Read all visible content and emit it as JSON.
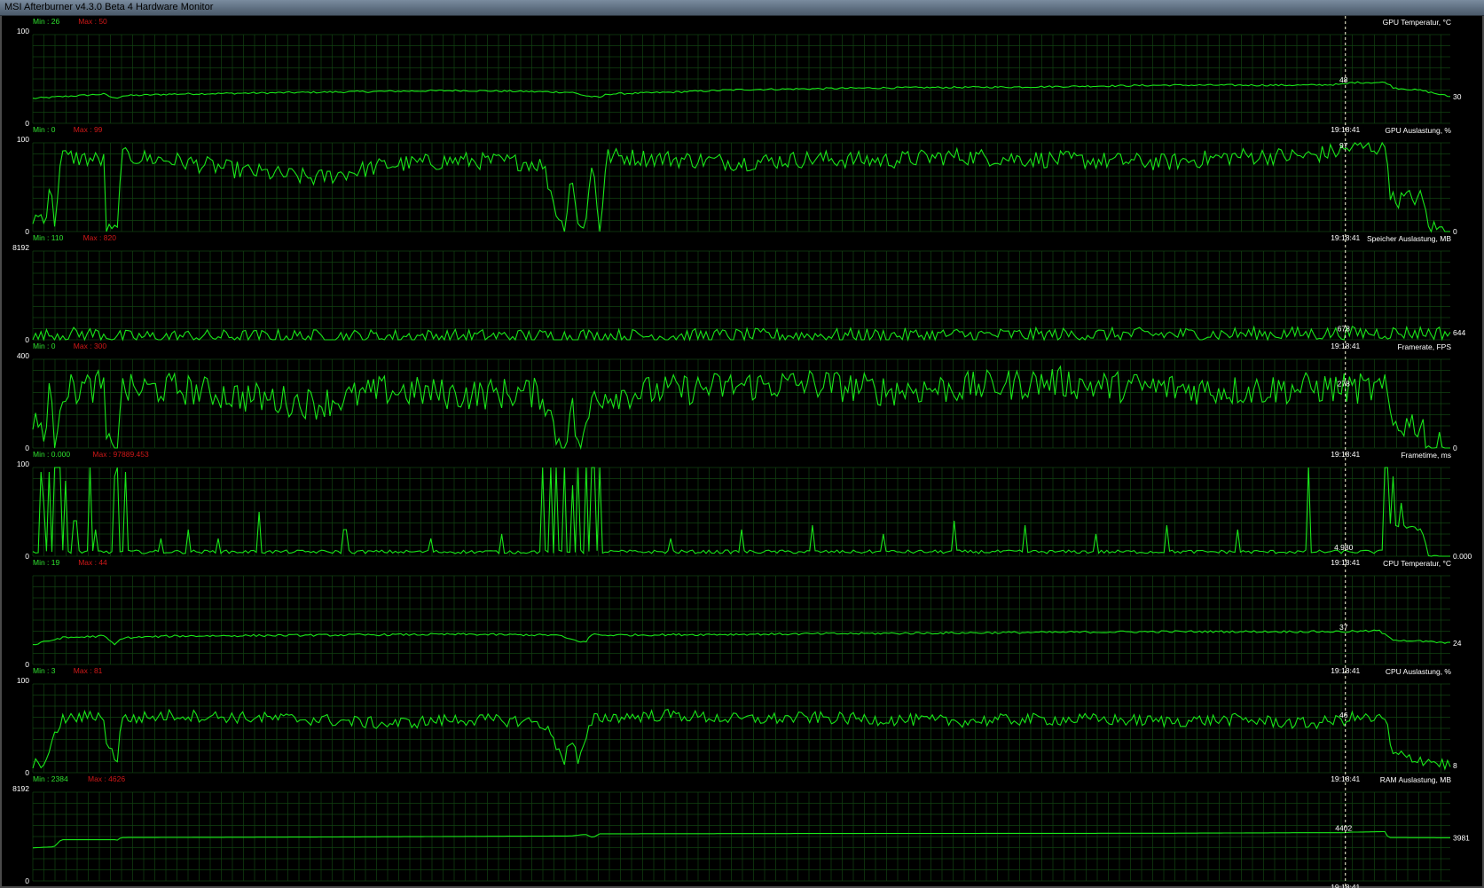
{
  "window": {
    "title": "MSI Afterburner v4.3.0 Beta 4 Hardware Monitor"
  },
  "colors": {
    "line": "#19e619",
    "grid": "#124212",
    "text": "#ffffff",
    "min": "#2fe02f",
    "max": "#d01818",
    "cursor": "#ffffe0"
  },
  "cursor": {
    "time": "19:18:41",
    "x_fraction": 0.926
  },
  "chart_data": [
    {
      "type": "line",
      "name": "GPU Temperatur, °C",
      "min_label": "Min : 26",
      "max_label": "Max : 50",
      "ylim": [
        0,
        100
      ],
      "y_top_label": "100",
      "y_bottom_label": "0",
      "cursor_value": "48",
      "current_value": "30",
      "points": [
        [
          0,
          28
        ],
        [
          0.02,
          30
        ],
        [
          0.05,
          33
        ],
        [
          0.058,
          28
        ],
        [
          0.063,
          31
        ],
        [
          0.1,
          33
        ],
        [
          0.2,
          35
        ],
        [
          0.3,
          37
        ],
        [
          0.38,
          35
        ],
        [
          0.39,
          31
        ],
        [
          0.4,
          29
        ],
        [
          0.405,
          33
        ],
        [
          0.45,
          35
        ],
        [
          0.5,
          38
        ],
        [
          0.6,
          40
        ],
        [
          0.7,
          41
        ],
        [
          0.8,
          43
        ],
        [
          0.9,
          43
        ],
        [
          0.926,
          44
        ],
        [
          0.93,
          46
        ],
        [
          0.955,
          46
        ],
        [
          0.96,
          40
        ],
        [
          0.98,
          37
        ],
        [
          1,
          30
        ]
      ],
      "noise": 1.0
    },
    {
      "type": "line",
      "name": "GPU Auslastung, %",
      "min_label": "Min : 0",
      "max_label": "Max : 99",
      "ylim": [
        0,
        100
      ],
      "y_top_label": "100",
      "y_bottom_label": "0",
      "cursor_value": "97",
      "current_value": "0",
      "points": [
        [
          0,
          15
        ],
        [
          0.01,
          20
        ],
        [
          0.012,
          60
        ],
        [
          0.015,
          5
        ],
        [
          0.02,
          85
        ],
        [
          0.05,
          80
        ],
        [
          0.052,
          0
        ],
        [
          0.06,
          0
        ],
        [
          0.062,
          85
        ],
        [
          0.1,
          80
        ],
        [
          0.15,
          68
        ],
        [
          0.2,
          60
        ],
        [
          0.25,
          75
        ],
        [
          0.3,
          80
        ],
        [
          0.35,
          78
        ],
        [
          0.36,
          75
        ],
        [
          0.37,
          20
        ],
        [
          0.375,
          0
        ],
        [
          0.38,
          70
        ],
        [
          0.385,
          0
        ],
        [
          0.39,
          15
        ],
        [
          0.395,
          80
        ],
        [
          0.4,
          0
        ],
        [
          0.405,
          85
        ],
        [
          0.45,
          82
        ],
        [
          0.5,
          78
        ],
        [
          0.55,
          82
        ],
        [
          0.6,
          80
        ],
        [
          0.65,
          85
        ],
        [
          0.7,
          82
        ],
        [
          0.75,
          80
        ],
        [
          0.8,
          78
        ],
        [
          0.85,
          85
        ],
        [
          0.9,
          85
        ],
        [
          0.926,
          92
        ],
        [
          0.93,
          95
        ],
        [
          0.955,
          95
        ],
        [
          0.958,
          40
        ],
        [
          0.96,
          35
        ],
        [
          0.97,
          38
        ],
        [
          0.98,
          38
        ],
        [
          0.985,
          5
        ],
        [
          1,
          0
        ]
      ],
      "noise": 10
    },
    {
      "type": "line",
      "name": "Speicher Auslastung, MB",
      "min_label": "Min : 110",
      "max_label": "Max : 820",
      "ylim": [
        0,
        8192
      ],
      "y_top_label": "8192",
      "y_bottom_label": "0",
      "cursor_value": "678",
      "current_value": "644",
      "points": [
        [
          0,
          110
        ],
        [
          0.015,
          520
        ],
        [
          0.05,
          560
        ],
        [
          0.058,
          250
        ],
        [
          0.1,
          300
        ],
        [
          0.2,
          320
        ],
        [
          0.38,
          350
        ],
        [
          0.39,
          500
        ],
        [
          0.395,
          200
        ],
        [
          0.4,
          350
        ],
        [
          0.5,
          400
        ],
        [
          0.6,
          420
        ],
        [
          0.7,
          450
        ],
        [
          0.8,
          500
        ],
        [
          0.9,
          560
        ],
        [
          0.926,
          600
        ],
        [
          0.95,
          650
        ],
        [
          1,
          644
        ]
      ],
      "noise": 8
    },
    {
      "type": "line",
      "name": "Framerate, FPS",
      "min_label": "Min : 0",
      "max_label": "Max : 300",
      "ylim": [
        0,
        400
      ],
      "y_top_label": "400",
      "y_bottom_label": "0",
      "cursor_value": "278",
      "current_value": "0",
      "points": [
        [
          0,
          100
        ],
        [
          0.01,
          100
        ],
        [
          0.012,
          280
        ],
        [
          0.015,
          0
        ],
        [
          0.02,
          260
        ],
        [
          0.05,
          280
        ],
        [
          0.052,
          0
        ],
        [
          0.06,
          0
        ],
        [
          0.062,
          260
        ],
        [
          0.1,
          270
        ],
        [
          0.15,
          230
        ],
        [
          0.2,
          200
        ],
        [
          0.25,
          260
        ],
        [
          0.3,
          240
        ],
        [
          0.35,
          250
        ],
        [
          0.36,
          240
        ],
        [
          0.37,
          50
        ],
        [
          0.375,
          0
        ],
        [
          0.38,
          200
        ],
        [
          0.385,
          0
        ],
        [
          0.39,
          50
        ],
        [
          0.395,
          250
        ],
        [
          0.4,
          240
        ],
        [
          0.45,
          260
        ],
        [
          0.5,
          280
        ],
        [
          0.55,
          290
        ],
        [
          0.6,
          260
        ],
        [
          0.65,
          270
        ],
        [
          0.7,
          290
        ],
        [
          0.72,
          300
        ],
        [
          0.75,
          280
        ],
        [
          0.8,
          270
        ],
        [
          0.85,
          260
        ],
        [
          0.9,
          270
        ],
        [
          0.926,
          270
        ],
        [
          0.93,
          270
        ],
        [
          0.955,
          260
        ],
        [
          0.958,
          120
        ],
        [
          0.96,
          110
        ],
        [
          0.98,
          110
        ],
        [
          0.985,
          0
        ],
        [
          1,
          0
        ]
      ],
      "noise": 18
    },
    {
      "type": "line",
      "name": "Frametime, ms",
      "min_label": "Min : 0.000",
      "max_label": "Max : 97889.453",
      "ylim": [
        0,
        100
      ],
      "y_top_label": "100",
      "y_bottom_label": "0",
      "cursor_value": "4.980",
      "current_value": "0.000",
      "points": [
        [
          0,
          5
        ],
        [
          0.2,
          5
        ],
        [
          0.4,
          5
        ],
        [
          0.6,
          5
        ],
        [
          0.8,
          5
        ],
        [
          0.926,
          5
        ],
        [
          0.955,
          5
        ],
        [
          0.958,
          40
        ],
        [
          0.96,
          35
        ],
        [
          0.98,
          30
        ],
        [
          0.985,
          0
        ],
        [
          1,
          0
        ]
      ],
      "spikes": [
        [
          0.005,
          95
        ],
        [
          0.008,
          60
        ],
        [
          0.012,
          95
        ],
        [
          0.015,
          100
        ],
        [
          0.018,
          100
        ],
        [
          0.02,
          100
        ],
        [
          0.023,
          85
        ],
        [
          0.03,
          40
        ],
        [
          0.04,
          100
        ],
        [
          0.045,
          30
        ],
        [
          0.058,
          90
        ],
        [
          0.06,
          100
        ],
        [
          0.065,
          95
        ],
        [
          0.09,
          20
        ],
        [
          0.11,
          30
        ],
        [
          0.13,
          20
        ],
        [
          0.16,
          50
        ],
        [
          0.22,
          30
        ],
        [
          0.28,
          20
        ],
        [
          0.33,
          25
        ],
        [
          0.36,
          100
        ],
        [
          0.365,
          100
        ],
        [
          0.37,
          100
        ],
        [
          0.375,
          100
        ],
        [
          0.38,
          80
        ],
        [
          0.385,
          100
        ],
        [
          0.39,
          100
        ],
        [
          0.395,
          100
        ],
        [
          0.4,
          100
        ],
        [
          0.45,
          20
        ],
        [
          0.5,
          30
        ],
        [
          0.55,
          35
        ],
        [
          0.6,
          25
        ],
        [
          0.65,
          40
        ],
        [
          0.7,
          35
        ],
        [
          0.75,
          25
        ],
        [
          0.8,
          35
        ],
        [
          0.85,
          30
        ],
        [
          0.9,
          100
        ],
        [
          0.955,
          100
        ],
        [
          0.96,
          90
        ],
        [
          0.965,
          60
        ]
      ],
      "noise": 2
    },
    {
      "type": "line",
      "name": "CPU Temperatur, °C",
      "min_label": "Min : 19",
      "max_label": "Max : 44",
      "ylim": [
        0,
        100
      ],
      "y_top_label": "",
      "y_bottom_label": "0",
      "cursor_value": "37",
      "current_value": "24",
      "points": [
        [
          0,
          22
        ],
        [
          0.02,
          30
        ],
        [
          0.05,
          32
        ],
        [
          0.058,
          22
        ],
        [
          0.063,
          30
        ],
        [
          0.1,
          32
        ],
        [
          0.2,
          33
        ],
        [
          0.3,
          34
        ],
        [
          0.37,
          33
        ],
        [
          0.38,
          28
        ],
        [
          0.39,
          25
        ],
        [
          0.395,
          35
        ],
        [
          0.4,
          33
        ],
        [
          0.5,
          34
        ],
        [
          0.6,
          35
        ],
        [
          0.7,
          36
        ],
        [
          0.8,
          37
        ],
        [
          0.9,
          37
        ],
        [
          0.926,
          37
        ],
        [
          0.95,
          38
        ],
        [
          0.955,
          32
        ],
        [
          0.96,
          28
        ],
        [
          1,
          24
        ]
      ],
      "noise": 1.2
    },
    {
      "type": "line",
      "name": "CPU Auslastung, %",
      "min_label": "Min : 3",
      "max_label": "Max : 81",
      "ylim": [
        0,
        100
      ],
      "y_top_label": "100",
      "y_bottom_label": "0",
      "cursor_value": "46",
      "current_value": "8",
      "points": [
        [
          0,
          8
        ],
        [
          0.01,
          15
        ],
        [
          0.02,
          60
        ],
        [
          0.05,
          65
        ],
        [
          0.052,
          30
        ],
        [
          0.06,
          15
        ],
        [
          0.062,
          60
        ],
        [
          0.1,
          65
        ],
        [
          0.15,
          62
        ],
        [
          0.2,
          60
        ],
        [
          0.25,
          55
        ],
        [
          0.3,
          60
        ],
        [
          0.35,
          58
        ],
        [
          0.36,
          55
        ],
        [
          0.37,
          30
        ],
        [
          0.375,
          15
        ],
        [
          0.38,
          40
        ],
        [
          0.385,
          10
        ],
        [
          0.39,
          35
        ],
        [
          0.395,
          60
        ],
        [
          0.4,
          62
        ],
        [
          0.45,
          65
        ],
        [
          0.5,
          60
        ],
        [
          0.55,
          62
        ],
        [
          0.6,
          60
        ],
        [
          0.65,
          58
        ],
        [
          0.7,
          60
        ],
        [
          0.75,
          60
        ],
        [
          0.8,
          58
        ],
        [
          0.85,
          60
        ],
        [
          0.9,
          55
        ],
        [
          0.926,
          60
        ],
        [
          0.93,
          62
        ],
        [
          0.955,
          60
        ],
        [
          0.958,
          25
        ],
        [
          0.96,
          20
        ],
        [
          0.98,
          15
        ],
        [
          1,
          8
        ]
      ],
      "noise": 7
    },
    {
      "type": "line",
      "name": "RAM Auslastung, MB",
      "min_label": "Min : 2384",
      "max_label": "Max : 4626",
      "ylim": [
        0,
        8192
      ],
      "y_top_label": "8192",
      "y_bottom_label": "0",
      "cursor_value": "4402",
      "current_value": "3981",
      "points": [
        [
          0,
          3050
        ],
        [
          0.015,
          3150
        ],
        [
          0.02,
          3800
        ],
        [
          0.058,
          3800
        ],
        [
          0.06,
          3750
        ],
        [
          0.062,
          4000
        ],
        [
          0.2,
          4050
        ],
        [
          0.38,
          4150
        ],
        [
          0.39,
          4300
        ],
        [
          0.395,
          4000
        ],
        [
          0.4,
          4350
        ],
        [
          0.6,
          4380
        ],
        [
          0.8,
          4400
        ],
        [
          0.9,
          4450
        ],
        [
          0.926,
          4450
        ],
        [
          0.93,
          4500
        ],
        [
          0.955,
          4550
        ],
        [
          0.956,
          4000
        ],
        [
          1,
          3981
        ]
      ],
      "noise": 0
    }
  ]
}
